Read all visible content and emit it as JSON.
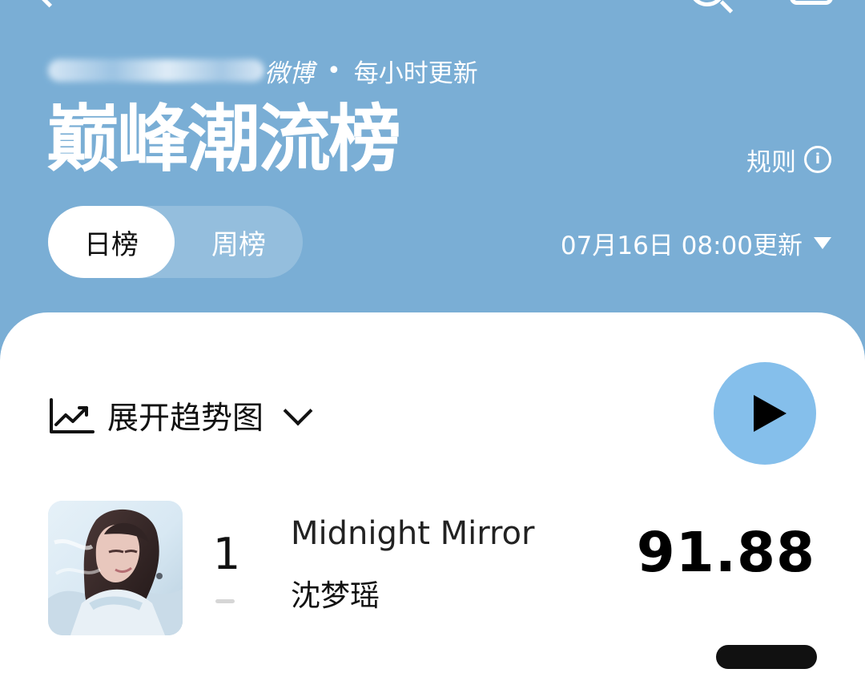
{
  "header": {
    "source_name": "微博",
    "separator": "•",
    "update_frequency": "每小时更新",
    "title": "巅峰潮流榜",
    "rules_label": "规则",
    "info_icon": "i"
  },
  "tabs": {
    "daily": "日榜",
    "weekly": "周榜",
    "active": "日榜"
  },
  "updated": {
    "label": "07月16日 08:00更新"
  },
  "controls": {
    "trend_label": "展开趋势图"
  },
  "rankings": [
    {
      "rank": "1",
      "title": "Midnight Mirror",
      "artist": "沈梦瑶",
      "score": "91.88",
      "change": "—"
    }
  ],
  "icons": {
    "back": "back-icon",
    "search": "search-icon",
    "menu": "menu-icon",
    "info": "info-icon",
    "trend": "trend-icon",
    "chevron": "chevron-down-icon",
    "play": "play-icon"
  },
  "colors": {
    "header_background": "#7aaed5",
    "panel_background": "#ffffff",
    "play_button": "#85bfeb",
    "text_dark": "#111111",
    "text_light": "#ffffff",
    "muted_dash": "#d6d6d6"
  }
}
